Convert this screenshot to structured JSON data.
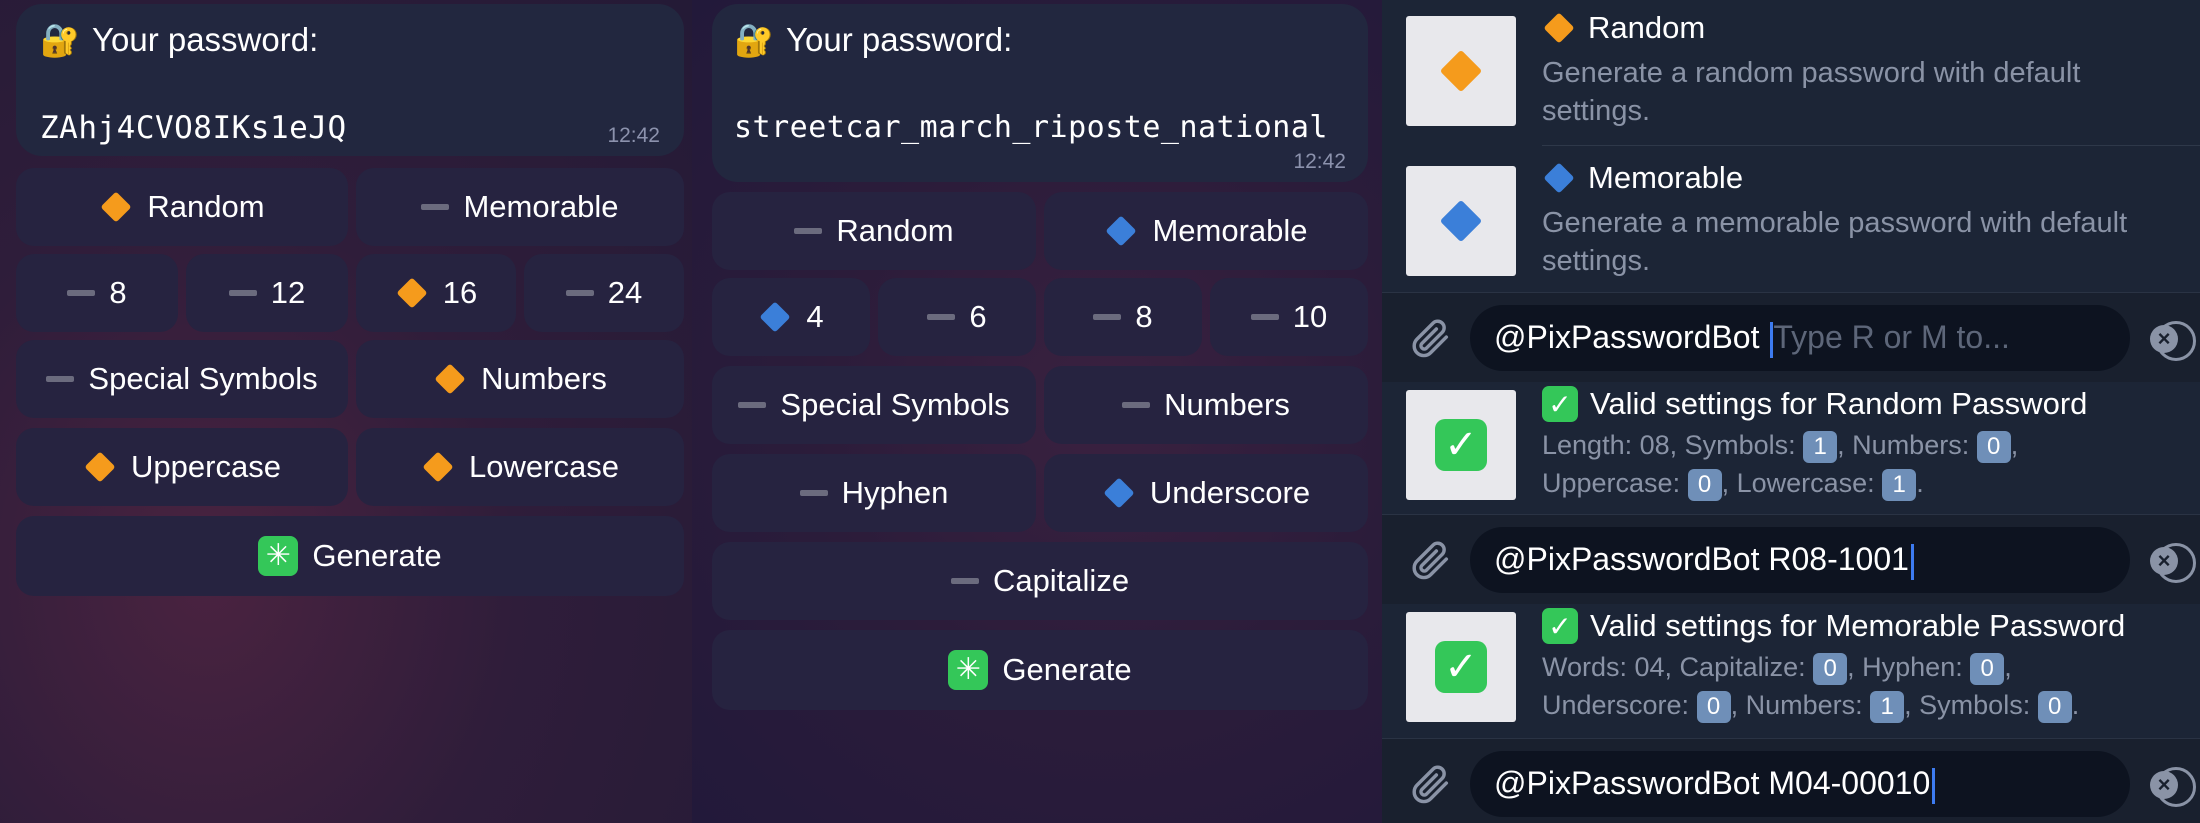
{
  "left": {
    "title": "Your password:",
    "password": "ZAhj4CVO8IKs1eJQ",
    "time": "12:42",
    "buttons": {
      "random": "Random",
      "memorable": "Memorable",
      "len8": "8",
      "len12": "12",
      "len16": "16",
      "len24": "24",
      "special": "Special Symbols",
      "numbers": "Numbers",
      "uppercase": "Uppercase",
      "lowercase": "Lowercase",
      "generate": "Generate"
    }
  },
  "middle": {
    "title": "Your password:",
    "password": "streetcar_march_riposte_national",
    "time": "12:42",
    "buttons": {
      "random": "Random",
      "memorable": "Memorable",
      "w4": "4",
      "w6": "6",
      "w8": "8",
      "w10": "10",
      "special": "Special Symbols",
      "numbers": "Numbers",
      "hyphen": "Hyphen",
      "underscore": "Underscore",
      "capitalize": "Capitalize",
      "generate": "Generate"
    }
  },
  "right": {
    "results1": [
      {
        "title": "Random",
        "desc": "Generate a random password with default settings."
      },
      {
        "title": "Memorable",
        "desc": "Generate a memorable password with default settings."
      }
    ],
    "input1": {
      "prefix": "@PixPasswordBot",
      "placeholder": "Type R or M to..."
    },
    "valid_random": {
      "title": "Valid settings for Random Password",
      "length_label": "Length: 08, Symbols:",
      "symbols": "1",
      "numbers_label": ", Numbers:",
      "numbers": "0",
      "upper_label": "Uppercase:",
      "upper": "0",
      "lower_label": ", Lowercase:",
      "lower": "1"
    },
    "input2": {
      "text": "@PixPasswordBot R08-1001"
    },
    "valid_memorable": {
      "title": "Valid settings for Memorable Password",
      "words_label": "Words: 04, Capitalize:",
      "capitalize": "0",
      "hyphen_label": ", Hyphen:",
      "hyphen": "0",
      "underscore_label": "Underscore:",
      "underscore": "0",
      "numbers_label": ", Numbers:",
      "numbers": "1",
      "symbols_label": ", Symbols:",
      "symbols": "0"
    },
    "input3": {
      "text": "@PixPasswordBot M04-00010"
    }
  },
  "colors": {
    "orange_diamond": "#f59b1c",
    "blue_diamond": "#3b7fd9",
    "green_check": "#34c759"
  }
}
